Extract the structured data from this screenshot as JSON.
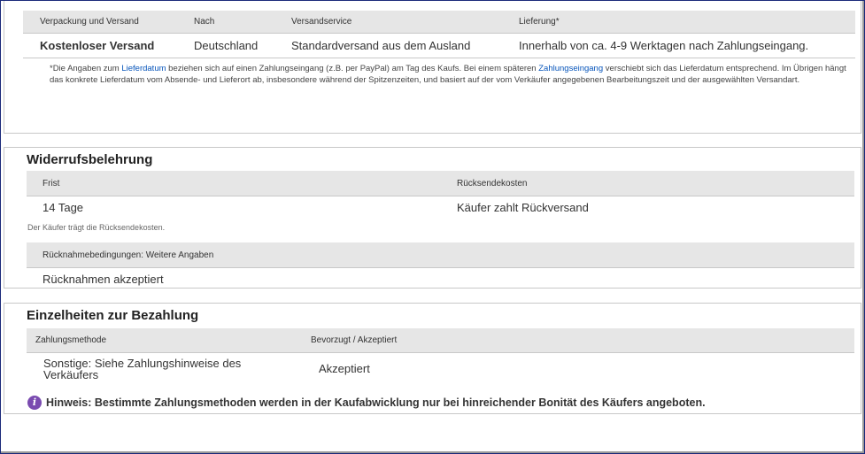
{
  "shipping": {
    "headers": {
      "packaging": "Verpackung und Versand",
      "to": "Nach",
      "service": "Versandservice",
      "delivery": "Lieferung*"
    },
    "row": {
      "cost": "Kostenloser Versand",
      "to": "Deutschland",
      "service": "Standardversand aus dem Ausland",
      "delivery": "Innerhalb von ca. 4-9 Werktagen nach Zahlungseingang."
    },
    "note": {
      "part1": "*Die Angaben zum ",
      "link1": "Lieferdatum",
      "part2": " beziehen sich auf einen Zahlungseingang (z.B. per PayPal) am Tag des Kaufs. Bei einem späteren ",
      "link2": "Zahlungseingang",
      "part3": " verschiebt sich das Lieferdatum entsprechend. Im Übrigen hängt das konkrete Lieferdatum vom Absende- und Lieferort ab, insbesondere während der Spitzenzeiten, und basiert auf der vom Verkäufer angegebenen Bearbeitungszeit und der ausgewählten Versandart."
    }
  },
  "returns": {
    "title": "Widerrufsbelehrung",
    "headers": {
      "period": "Frist",
      "cost": "Rücksendekosten"
    },
    "row": {
      "period": "14 Tage",
      "cost": "Käufer zahlt Rückversand"
    },
    "buyer_note": "Der Käufer trägt die Rücksendekosten.",
    "conditions_header": "Rücknahmebedingungen: Weitere Angaben",
    "conditions_value": "Rücknahmen akzeptiert"
  },
  "payment": {
    "title": "Einzelheiten zur Bezahlung",
    "headers": {
      "method": "Zahlungsmethode",
      "preferred": "Bevorzugt / Akzeptiert"
    },
    "row": {
      "method": "Sonstige: Siehe Zahlungshinweise des Verkäufers",
      "status": "Akzeptiert"
    },
    "hint": "Hinweis: Bestimmte Zahlungsmethoden werden in der Kaufabwicklung nur bei hinreichender Bonität des Käufers angeboten.",
    "hint_icon": "info-icon"
  },
  "colors": {
    "frame": "#1b2a7a",
    "header_bg": "#e6e6e6",
    "link": "#0654ba",
    "info_icon": "#7a4bb0"
  }
}
